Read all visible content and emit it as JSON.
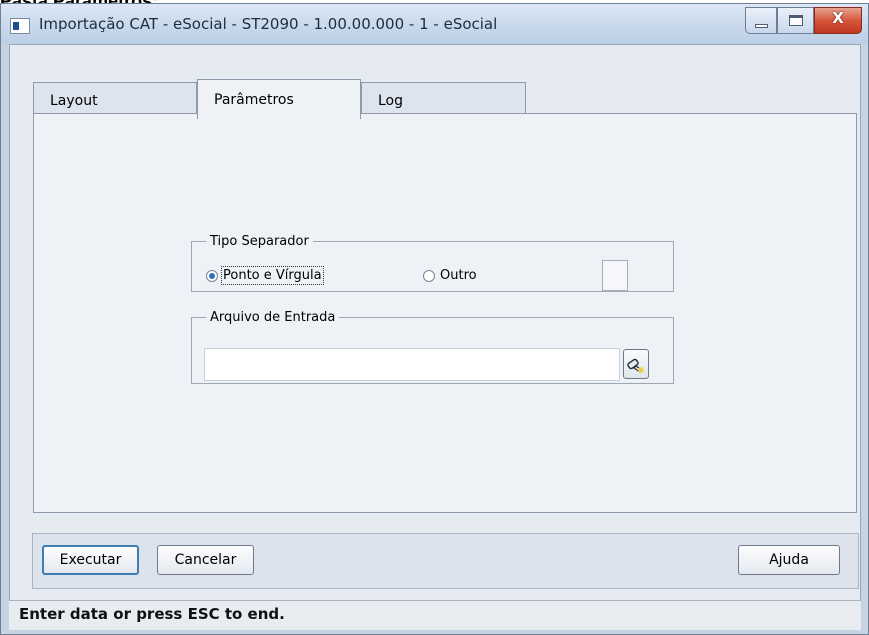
{
  "page_heading": "Pasta Parâmetros:",
  "window": {
    "title": "Importação CAT - eSocial - ST2090 - 1.00.00.000 - 1 - eSocial",
    "close_glyph": "X"
  },
  "tabs": [
    {
      "label": "Layout",
      "active": false
    },
    {
      "label": "Parâmetros",
      "active": true
    },
    {
      "label": "Log",
      "active": false
    }
  ],
  "tipo_separador": {
    "legend": "Tipo Separador",
    "options": [
      {
        "label": "Ponto e Vírgula",
        "checked": true
      },
      {
        "label": "Outro",
        "checked": false
      }
    ],
    "outro_value": ""
  },
  "arquivo_entrada": {
    "legend": "Arquivo de Entrada",
    "value": "",
    "browse_icon": "flashlight-icon"
  },
  "buttons": {
    "executar": "Executar",
    "cancelar": "Cancelar",
    "ajuda": "Ajuda"
  },
  "status": "Enter data or press ESC to end.",
  "colors": {
    "window_frame": "#c6d3e3",
    "client_bg": "#e6ebf2",
    "default_button_border": "#3c7fb1",
    "radio_selected": "#2f6ec4",
    "close_button": "#c0381f"
  }
}
